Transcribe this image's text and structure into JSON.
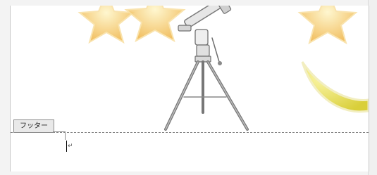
{
  "footer": {
    "tab_label": "フッター",
    "paragraph_mark": "↵"
  },
  "decoration": {
    "stars_color": "#f6c85a",
    "moon_color": "#e9e04a",
    "telescope_color": "#6f6f6f"
  }
}
